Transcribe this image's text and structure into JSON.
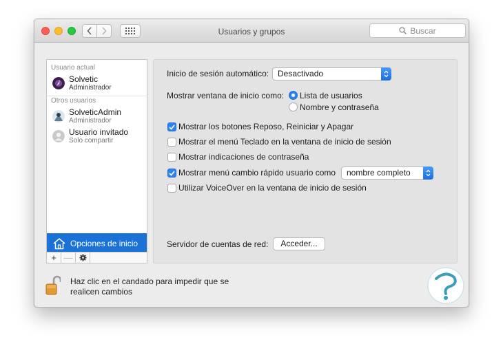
{
  "window": {
    "title": "Usuarios y grupos"
  },
  "search": {
    "placeholder": "Buscar"
  },
  "sidebar": {
    "current_header": "Usuario actual",
    "current_user": {
      "name": "Solvetic",
      "role": "Administrador"
    },
    "others_header": "Otros usuarios",
    "other_users": [
      {
        "name": "SolveticAdmin",
        "role": "Administrador"
      },
      {
        "name": "Usuario invitado",
        "role": "Solo compartir"
      }
    ],
    "login_options": "Opciones de inicio",
    "toolbar": {
      "add": "+",
      "remove": "—"
    }
  },
  "panel": {
    "auto_login_label": "Inicio de sesión automático:",
    "auto_login_value": "Desactivado",
    "login_window_label": "Mostrar ventana de inicio como:",
    "radio_list": {
      "label": "Lista de usuarios",
      "selected": true
    },
    "radio_name": {
      "label": "Nombre y contraseña",
      "selected": false
    },
    "checkboxes": [
      {
        "label": "Mostrar los botones Reposo, Reiniciar y Apagar",
        "checked": true
      },
      {
        "label": "Mostrar el menú Teclado en la ventana de inicio de sesión",
        "checked": false
      },
      {
        "label": "Mostrar indicaciones de contraseña",
        "checked": false
      },
      {
        "label": "Mostrar menú cambio rápido usuario como",
        "checked": true
      },
      {
        "label": "Utilizar VoiceOver en la ventana de inicio de sesión",
        "checked": false
      }
    ],
    "fast_switch_value": "nombre completo",
    "network_server_label": "Servidor de cuentas de red:",
    "join_button": "Acceder..."
  },
  "footer": {
    "lock_text": "Haz clic en el candado para impedir que se realicen cambios"
  },
  "colors": {
    "accent": "#1b72d6",
    "checkbox": "#2d84f0",
    "watermark": "#3aa0b8"
  },
  "icons": [
    "back-icon",
    "forward-icon",
    "grid-icon",
    "search-icon",
    "house-icon",
    "gear-icon",
    "padlock-icon",
    "chevron-updown-icon",
    "checkmark-icon"
  ]
}
